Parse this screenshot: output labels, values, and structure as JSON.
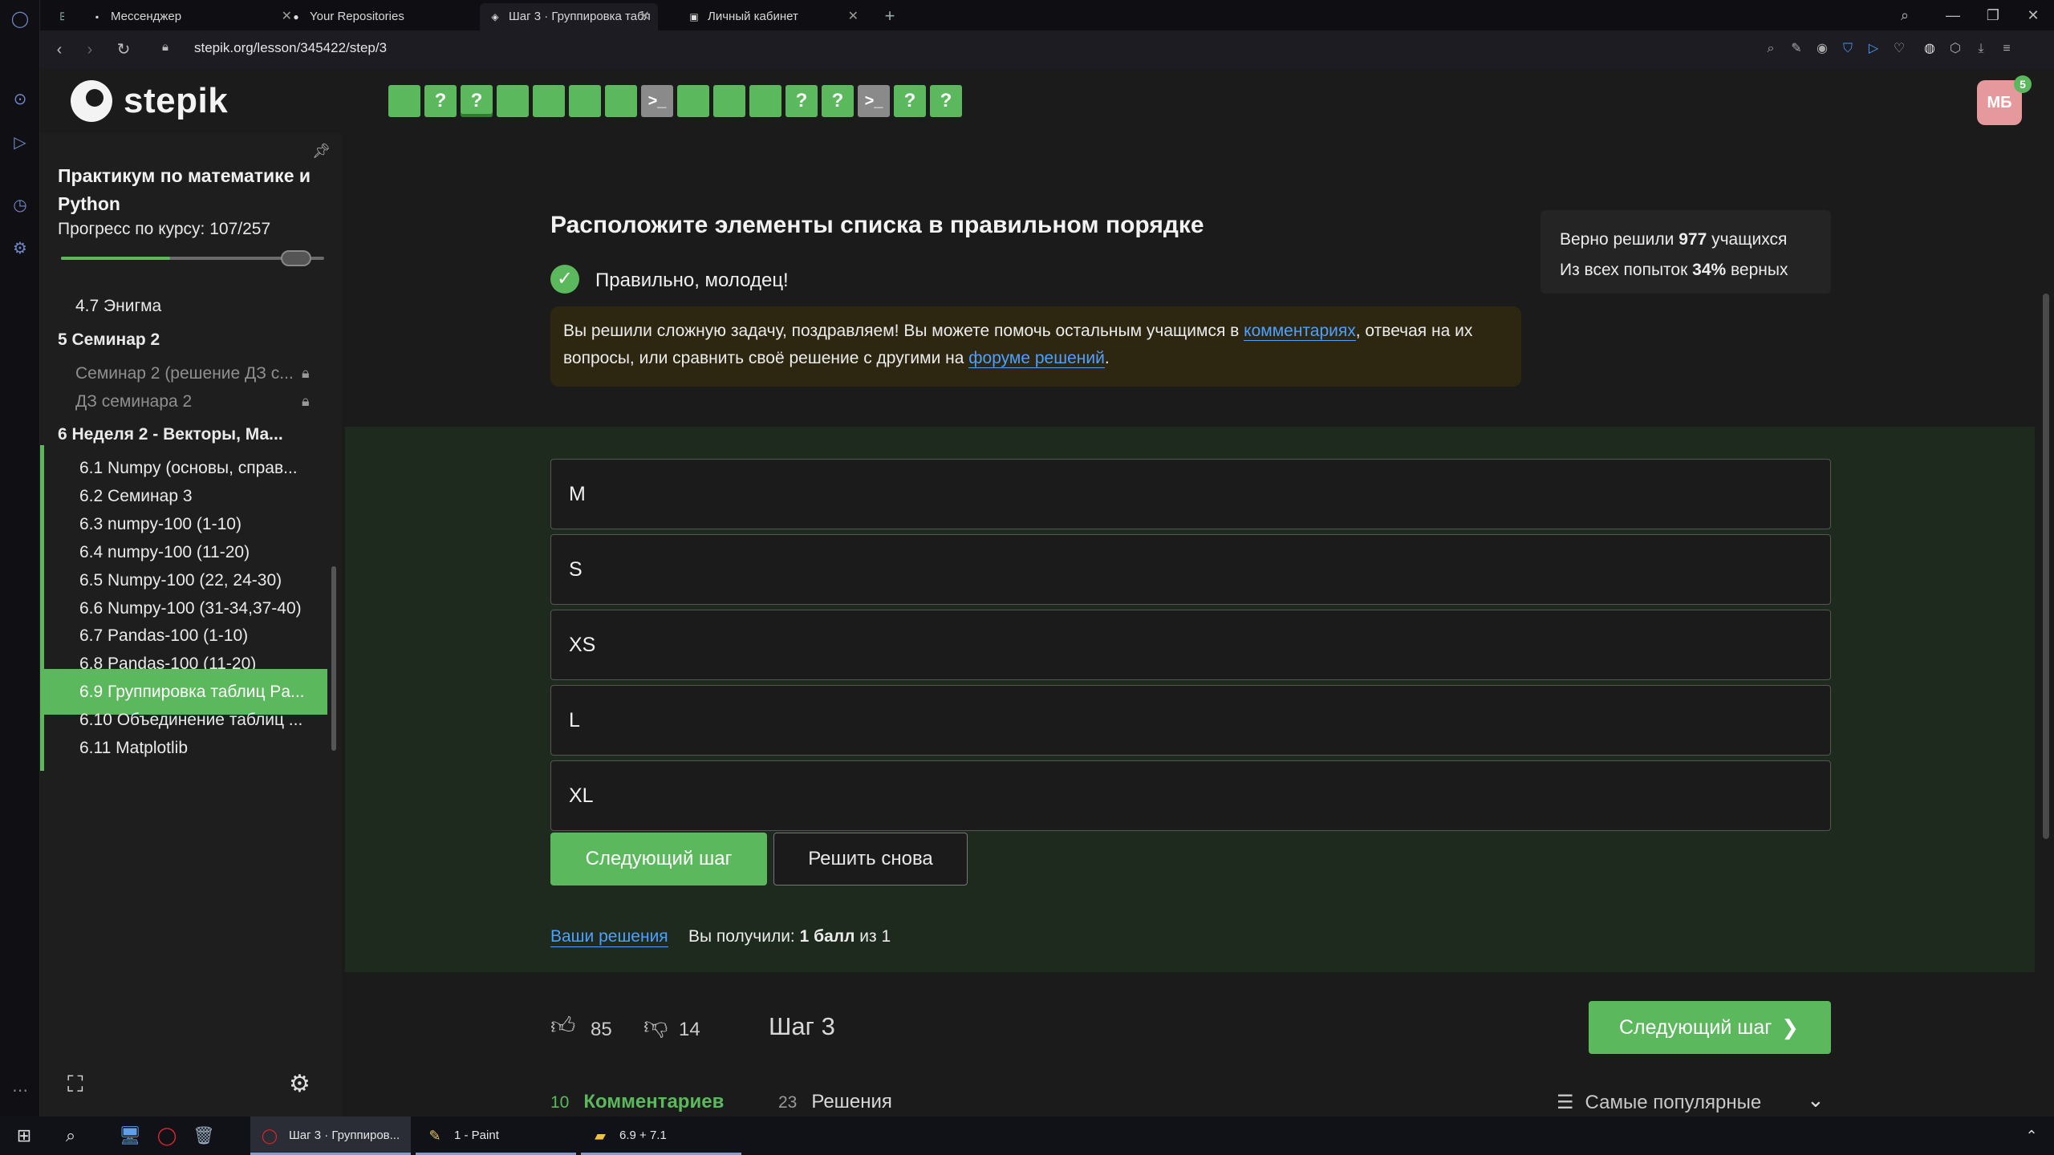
{
  "browser": {
    "tabs": [
      {
        "title": "Мессенджер",
        "icon": "messenger-icon"
      },
      {
        "title": "Your Repositories",
        "icon": "github-icon"
      },
      {
        "title": "Шаг 3 · Группировка табл",
        "icon": "stepik-icon"
      },
      {
        "title": "Личный кабинет",
        "icon": "cabinet-icon"
      }
    ],
    "url": "stepik.org/lesson/345422/step/3"
  },
  "header": {
    "logo_text": "stepik",
    "steps": [
      {
        "kind": "done",
        "label": ""
      },
      {
        "kind": "question",
        "label": "?"
      },
      {
        "kind": "question",
        "label": "?"
      },
      {
        "kind": "done",
        "label": ""
      },
      {
        "kind": "done",
        "label": ""
      },
      {
        "kind": "done",
        "label": ""
      },
      {
        "kind": "done",
        "label": ""
      },
      {
        "kind": "code",
        "label": ">_"
      },
      {
        "kind": "done",
        "label": ""
      },
      {
        "kind": "done",
        "label": ""
      },
      {
        "kind": "done",
        "label": ""
      },
      {
        "kind": "question",
        "label": "?"
      },
      {
        "kind": "question",
        "label": "?"
      },
      {
        "kind": "code",
        "label": ">_"
      },
      {
        "kind": "question",
        "label": "?"
      },
      {
        "kind": "question",
        "label": "?"
      }
    ],
    "current_step": 3,
    "avatar_initials": "МБ",
    "notifications": "5"
  },
  "sidebar": {
    "course_title": "Практикум по математике и Python",
    "progress_text": "Прогресс по курсу: 107/257",
    "progress_fraction": 0.416,
    "lessons": [
      {
        "label": "4.7  Энигма",
        "kind": "lesson"
      },
      {
        "label": "5  Семинар 2",
        "kind": "module"
      },
      {
        "label": "Семинар 2 (решение ДЗ с...",
        "kind": "locked"
      },
      {
        "label": "ДЗ семинара 2",
        "kind": "locked"
      },
      {
        "label": "6  Неделя 2 - Векторы, Ма...",
        "kind": "module"
      },
      {
        "label": "6.1  Numpy (основы, справ...",
        "kind": "lesson"
      },
      {
        "label": "6.2  Семинар 3",
        "kind": "lesson"
      },
      {
        "label": "6.3  numpy-100 (1-10)",
        "kind": "lesson"
      },
      {
        "label": "6.4  numpy-100 (11-20)",
        "kind": "lesson"
      },
      {
        "label": "6.5  Numpy-100 (22, 24-30)",
        "kind": "lesson"
      },
      {
        "label": "6.6  Numpy-100 (31-34,37-40)",
        "kind": "lesson"
      },
      {
        "label": "6.7  Pandas-100 (1-10)",
        "kind": "lesson"
      },
      {
        "label": "6.8  Pandas-100 (11-20)",
        "kind": "lesson"
      },
      {
        "label": "6.9  Группировка таблиц Pa...",
        "kind": "active"
      },
      {
        "label": "6.10  Объединение таблиц ...",
        "kind": "lesson"
      },
      {
        "label": "6.11  Matplotlib",
        "kind": "lesson"
      }
    ]
  },
  "main": {
    "task_title": "Расположите элементы списка в правильном порядке",
    "correct_text": "Правильно, молодец!",
    "hint": {
      "before": "Вы решили сложную задачу, поздравляем! Вы можете помочь остальным учащимся в ",
      "link1": "комментариях",
      "middle": ", отвечая на их вопросы, или сравнить своё решение с другими на ",
      "link2": "форуме решений",
      "after": "."
    },
    "stats": {
      "line1_prefix": "Верно решили ",
      "solved_count": "977",
      "line1_suffix": " учащихся",
      "line2_prefix": "Из всех попыток ",
      "percent": "34%",
      "line2_suffix": " верных"
    },
    "items": [
      "M",
      "S",
      "XS",
      "L",
      "XL"
    ],
    "next_button": "Следующий шаг",
    "retry_button": "Решить снова",
    "your_solutions": "Ваши решения",
    "score": {
      "prefix": "Вы получили: ",
      "value": "1 балл",
      "suffix": " из 1"
    },
    "likes": "85",
    "dislikes": "14",
    "step_label": "Шаг 3",
    "next_step_big": "Следующий шаг",
    "comments": {
      "count": "10",
      "label": "Комментариев"
    },
    "solutions": {
      "count": "23",
      "label": "Решения"
    },
    "sort_label": "Самые популярные"
  },
  "taskbar": {
    "apps": [
      {
        "label": "Шаг 3 · Группиров...",
        "icon": "opera-icon"
      },
      {
        "label": "1 - Paint",
        "icon": "paint-icon"
      },
      {
        "label": "6.9 + 7.1",
        "icon": "folder-icon"
      }
    ]
  },
  "colors": {
    "accent": "#5cb85c",
    "link": "#4ea0ff",
    "hint_bg": "#2d2712",
    "answer_bg": "#1d2a1d"
  }
}
